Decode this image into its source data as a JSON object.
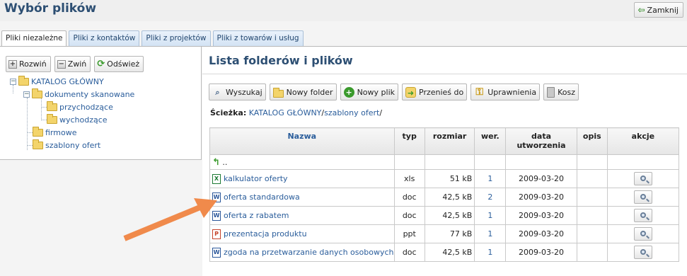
{
  "window": {
    "title": "Wybór plików",
    "close_label": "Zamknij"
  },
  "tabs": [
    {
      "label": "Pliki niezależne",
      "active": true
    },
    {
      "label": "Pliki z kontaktów",
      "active": false
    },
    {
      "label": "Pliki z projektów",
      "active": false
    },
    {
      "label": "Pliki z towarów i usług",
      "active": false
    }
  ],
  "tree_toolbar": {
    "expand_label": "Rozwiń",
    "collapse_label": "Zwiń",
    "refresh_label": "Odśwież"
  },
  "tree": {
    "root": "KATALOG GŁÓWNY",
    "scanned": "dokumenty skanowane",
    "incoming": "przychodzące",
    "outgoing": "wychodzące",
    "company": "firmowe",
    "templates": "szablony ofert"
  },
  "main": {
    "heading": "Lista folderów i plików",
    "toolbar": {
      "search": "Wyszukaj",
      "new_folder": "Nowy folder",
      "new_file": "Nowy plik",
      "move_to": "Przenieś do",
      "permissions": "Uprawnienia",
      "trash": "Kosz"
    },
    "path": {
      "label": "Ścieżka:",
      "segment1": "KATALOG GŁÓWNY",
      "separator": "/",
      "segment2": "szablony ofert",
      "trailing": "/"
    }
  },
  "table": {
    "headers": {
      "name": "Nazwa",
      "type": "typ",
      "size": "rozmiar",
      "version": "wer.",
      "created": "data utworzenia",
      "description": "opis",
      "actions": "akcje"
    },
    "up_label": "..",
    "rows": [
      {
        "name": "kalkulator oferty",
        "type": "xls",
        "size": "51 kB",
        "version": "1",
        "date": "2009-03-20",
        "icon": "excel-icon"
      },
      {
        "name": "oferta standardowa",
        "type": "doc",
        "size": "42,5 kB",
        "version": "2",
        "date": "2009-03-20",
        "icon": "word-icon"
      },
      {
        "name": "oferta z rabatem",
        "type": "doc",
        "size": "42,5 kB",
        "version": "1",
        "date": "2009-03-20",
        "icon": "word-icon"
      },
      {
        "name": "prezentacja produktu",
        "type": "ppt",
        "size": "77 kB",
        "version": "1",
        "date": "2009-03-20",
        "icon": "powerpoint-icon"
      },
      {
        "name": "zgoda na przetwarzanie danych osobowych",
        "type": "doc",
        "size": "42,5 kB",
        "version": "1",
        "date": "2009-03-20",
        "icon": "word-icon"
      }
    ]
  },
  "colors": {
    "title": "#2d4f73",
    "link": "#2a5d9b",
    "arrow": "#f08a4b"
  }
}
